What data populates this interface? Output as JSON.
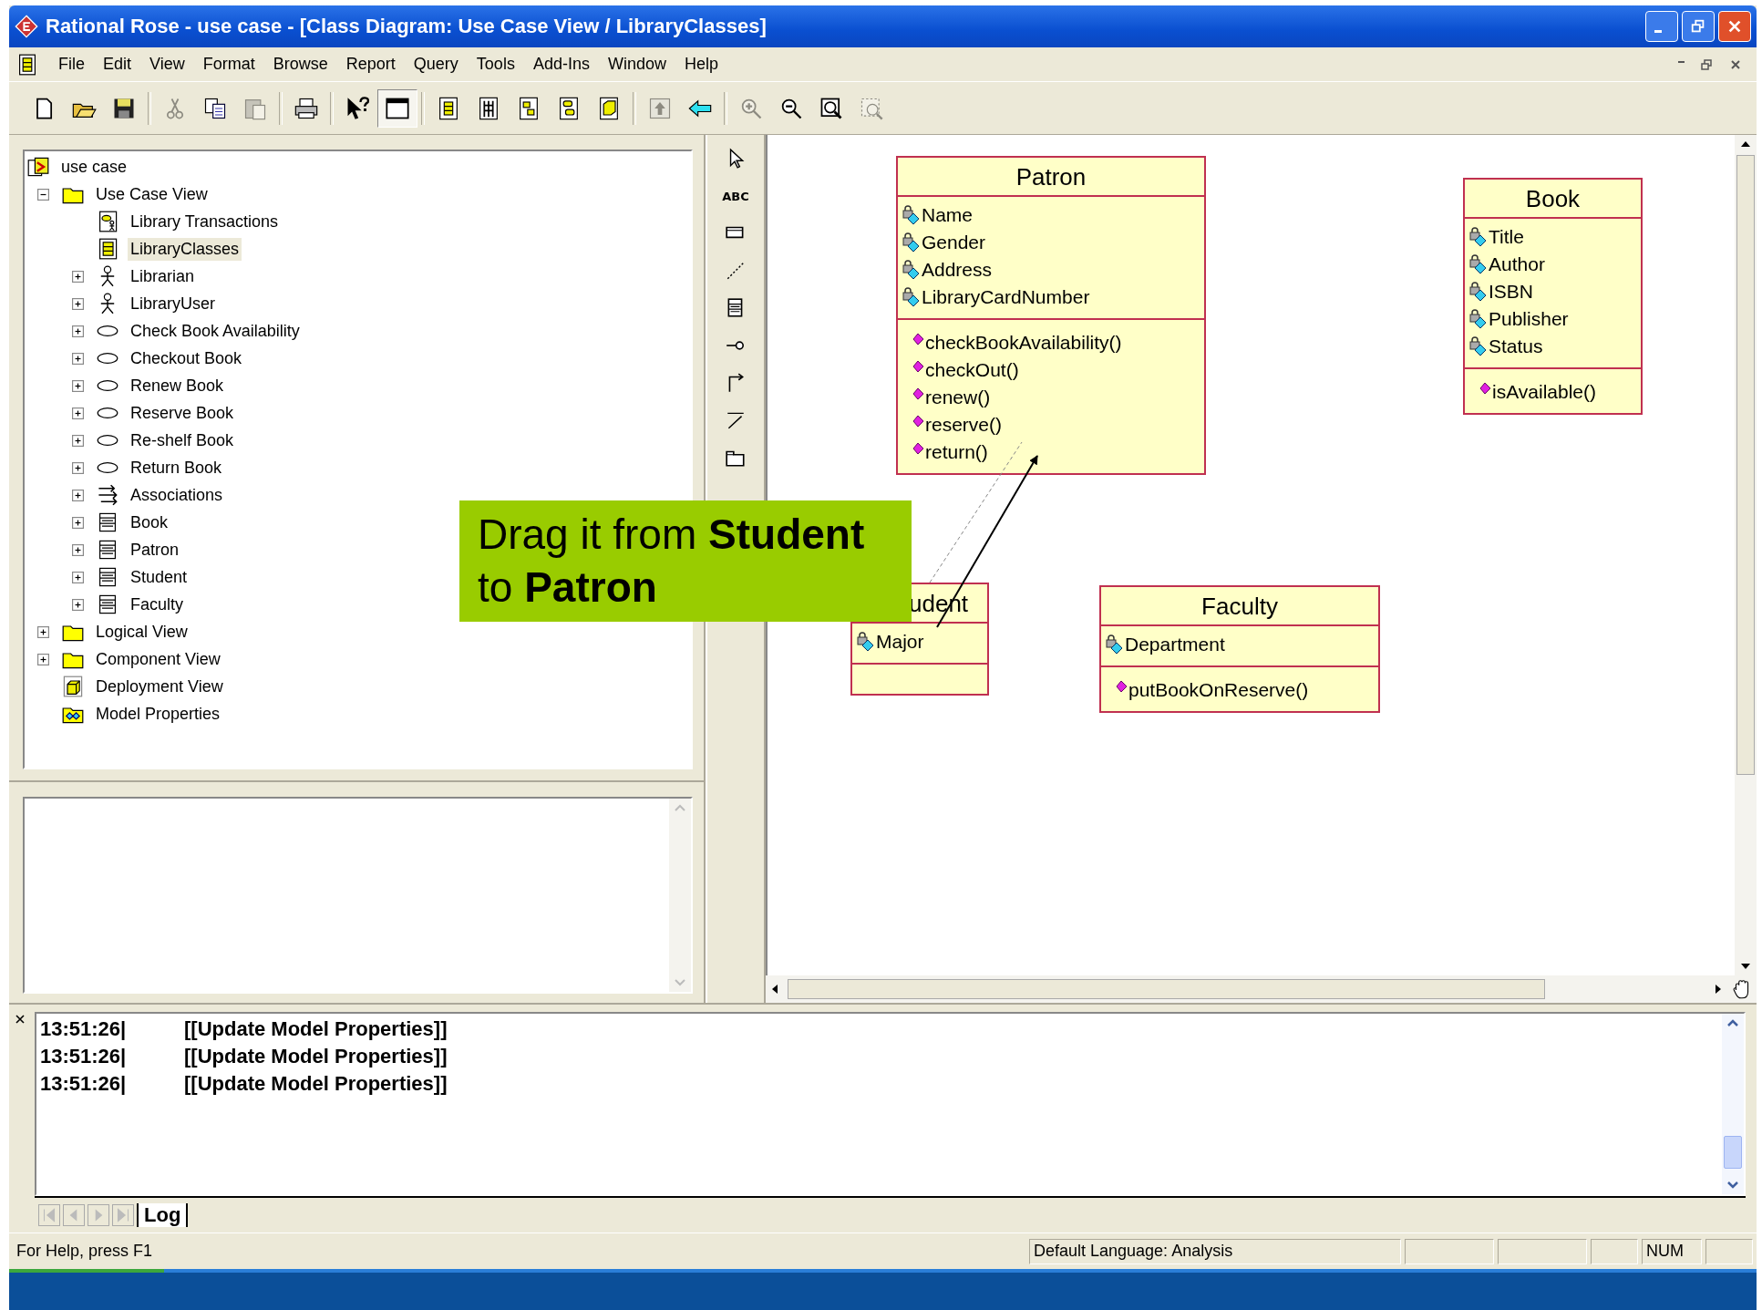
{
  "window": {
    "title": "Rational Rose - use case - [Class Diagram: Use Case View / LibraryClasses]"
  },
  "menu": [
    "File",
    "Edit",
    "View",
    "Format",
    "Browse",
    "Report",
    "Query",
    "Tools",
    "Add-Ins",
    "Window",
    "Help"
  ],
  "toolbar": [
    [
      {
        "kind": "new",
        "disabled": false,
        "pressed": false
      },
      {
        "kind": "open",
        "disabled": false,
        "pressed": false
      },
      {
        "kind": "save",
        "disabled": false,
        "pressed": false
      }
    ],
    [
      {
        "kind": "cut",
        "disabled": true,
        "pressed": false
      },
      {
        "kind": "copy",
        "disabled": false,
        "pressed": false
      },
      {
        "kind": "paste",
        "disabled": true,
        "pressed": false
      }
    ],
    [
      {
        "kind": "print",
        "disabled": false,
        "pressed": false
      }
    ],
    [
      {
        "kind": "help",
        "disabled": false,
        "pressed": false
      },
      {
        "kind": "browser",
        "disabled": false,
        "pressed": true
      }
    ],
    [
      {
        "kind": "diagram",
        "disabled": false,
        "pressed": false
      },
      {
        "kind": "sequence",
        "disabled": false,
        "pressed": false
      },
      {
        "kind": "collab",
        "disabled": false,
        "pressed": false
      },
      {
        "kind": "state",
        "disabled": false,
        "pressed": false
      },
      {
        "kind": "component",
        "disabled": false,
        "pressed": false
      }
    ],
    [
      {
        "kind": "up",
        "disabled": true,
        "pressed": false
      },
      {
        "kind": "back",
        "disabled": false,
        "pressed": false
      }
    ],
    [
      {
        "kind": "zoomin",
        "disabled": true,
        "pressed": false
      },
      {
        "kind": "zoomout",
        "disabled": false,
        "pressed": false
      },
      {
        "kind": "fit",
        "disabled": false,
        "pressed": false
      },
      {
        "kind": "fitsel",
        "disabled": true,
        "pressed": false
      }
    ]
  ],
  "browser": {
    "root": {
      "label": "use case",
      "kind": "root",
      "selected": false,
      "children": [
        {
          "label": "Use Case View",
          "kind": "folder",
          "selected": false,
          "expanded": true,
          "children": [
            {
              "label": "Library Transactions",
              "kind": "usecase-diagram",
              "selected": false
            },
            {
              "label": "LibraryClasses",
              "kind": "class-diagram",
              "selected": true
            },
            {
              "label": "Librarian",
              "kind": "actor",
              "selected": false,
              "expanded": false
            },
            {
              "label": "LibraryUser",
              "kind": "actor",
              "selected": false,
              "expanded": false
            },
            {
              "label": "Check Book Availability",
              "kind": "usecase",
              "selected": false,
              "expanded": false
            },
            {
              "label": "Checkout Book",
              "kind": "usecase",
              "selected": false,
              "expanded": false
            },
            {
              "label": "Renew Book",
              "kind": "usecase",
              "selected": false,
              "expanded": false
            },
            {
              "label": "Reserve Book",
              "kind": "usecase",
              "selected": false,
              "expanded": false
            },
            {
              "label": "Re-shelf Book",
              "kind": "usecase",
              "selected": false,
              "expanded": false
            },
            {
              "label": "Return Book",
              "kind": "usecase",
              "selected": false,
              "expanded": false
            },
            {
              "label": "Associations",
              "kind": "associations",
              "selected": false,
              "expanded": false
            },
            {
              "label": "Book",
              "kind": "class",
              "selected": false,
              "expanded": false
            },
            {
              "label": "Patron",
              "kind": "class",
              "selected": false,
              "expanded": false
            },
            {
              "label": "Student",
              "kind": "class",
              "selected": false,
              "expanded": false
            },
            {
              "label": "Faculty",
              "kind": "class",
              "selected": false,
              "expanded": false
            }
          ]
        },
        {
          "label": "Logical View",
          "kind": "folder",
          "selected": false,
          "expanded": false
        },
        {
          "label": "Component View",
          "kind": "folder",
          "selected": false,
          "expanded": false
        },
        {
          "label": "Deployment View",
          "kind": "deployment",
          "selected": false
        },
        {
          "label": "Model Properties",
          "kind": "properties",
          "selected": false
        }
      ]
    }
  },
  "palette": [
    {
      "kind": "pointer"
    },
    {
      "kind": "text",
      "label": "ABC"
    },
    {
      "kind": "note"
    },
    {
      "kind": "anchor"
    },
    {
      "kind": "class"
    },
    {
      "kind": "interface"
    },
    {
      "kind": "association"
    },
    {
      "kind": "dependency"
    },
    {
      "kind": "package"
    }
  ],
  "diagram": {
    "classes": [
      {
        "name": "Patron",
        "attributes": [
          "Name",
          "Gender",
          "Address",
          "LibraryCardNumber"
        ],
        "operations": [
          "checkBookAvailability()",
          "checkOut()",
          "renew()",
          "reserve()",
          "return()"
        ]
      },
      {
        "name": "Book",
        "attributes": [
          "Title",
          "Author",
          "ISBN",
          "Publisher",
          "Status"
        ],
        "operations": [
          "isAvailable()"
        ]
      },
      {
        "name": "udent",
        "attributes": [
          "Major"
        ]
      },
      {
        "name": "Faculty",
        "attributes": [
          "Department"
        ],
        "operations": [
          "putBookOnReserve()"
        ]
      }
    ],
    "callout": "Drag it from **Student** to **Patron**"
  },
  "log": {
    "lines": [
      {
        "time": "13:51:26|",
        "message": "[[Update Model Properties]]"
      },
      {
        "time": "13:51:26|",
        "message": "[[Update Model Properties]]"
      },
      {
        "time": "13:51:26|",
        "message": "[[Update Model Properties]]"
      }
    ],
    "tabs": [
      {
        "label": "Log",
        "selected": true
      }
    ]
  },
  "status_bar": {
    "help": "For Help, press F1",
    "language": "Default Language: Analysis",
    "num": "NUM"
  }
}
